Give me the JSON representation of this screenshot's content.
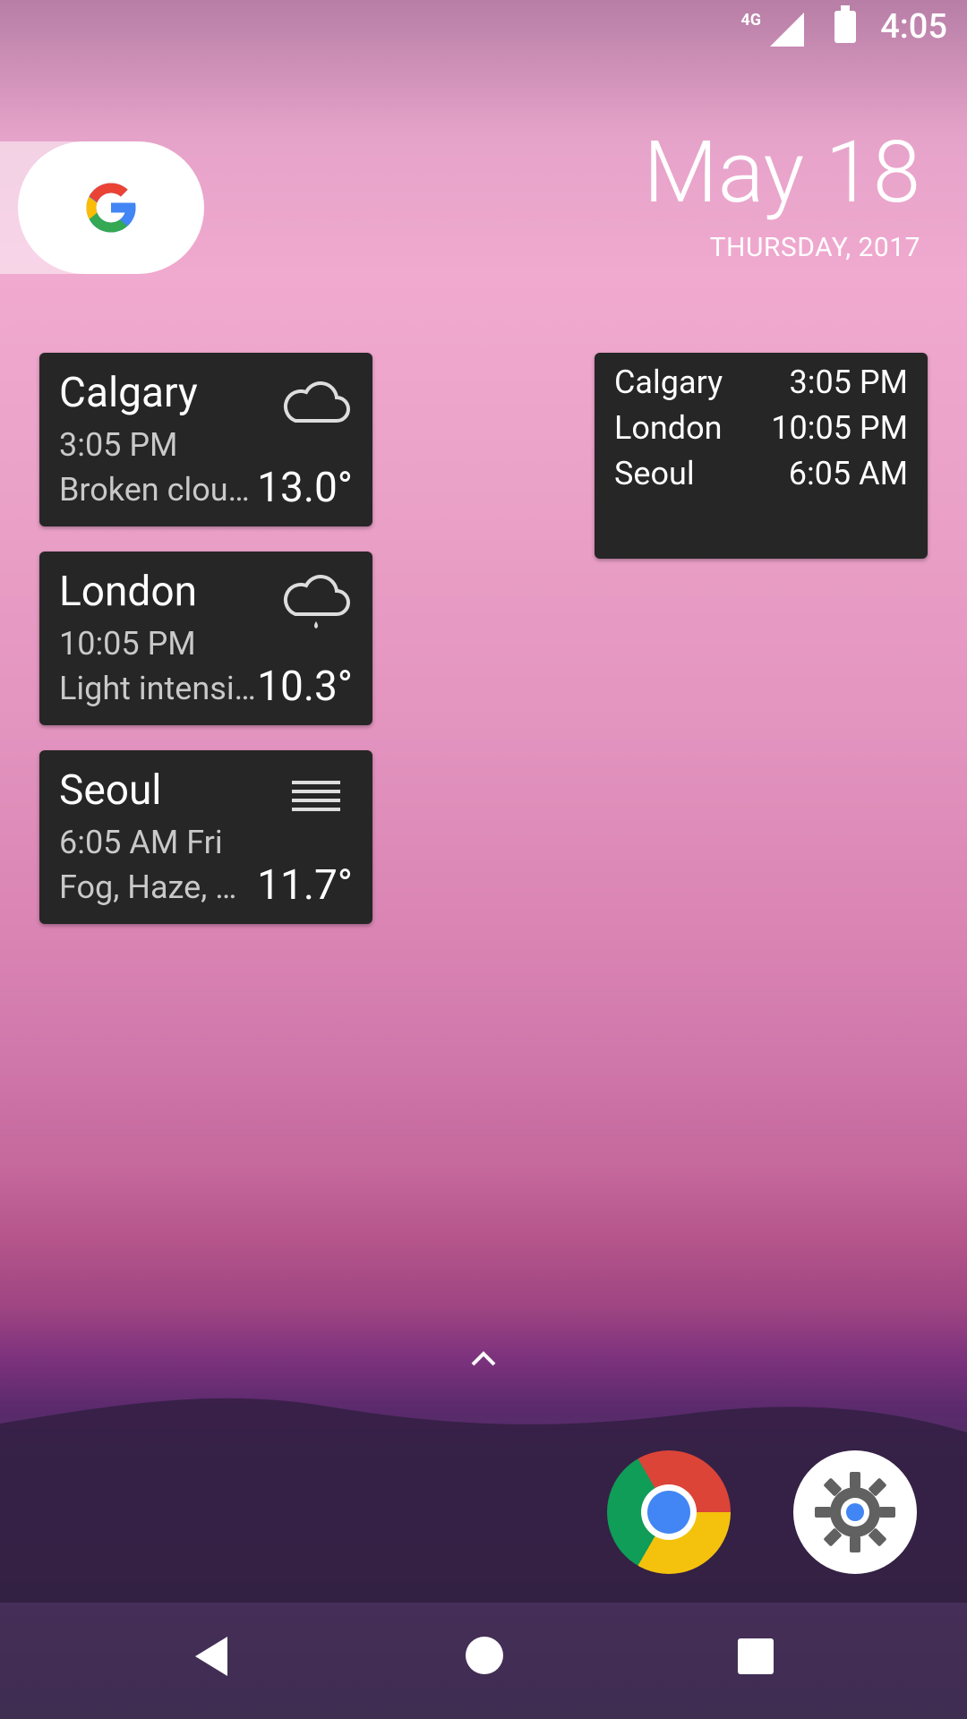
{
  "status_bar": {
    "network": "4G",
    "time": "4:05"
  },
  "search_widget": {
    "logo_name": "google-g-icon"
  },
  "date_widget": {
    "date": "May 18",
    "day_year": "THURSDAY, 2017"
  },
  "weather_cards": [
    {
      "city": "Calgary",
      "time": "3:05 PM",
      "desc": "Broken clouds",
      "temp": "13.0°",
      "icon": "cloud-icon"
    },
    {
      "city": "London",
      "time": "10:05 PM",
      "desc": "Light intensity drizzle",
      "temp": "10.3°",
      "icon": "rain-cloud-icon"
    },
    {
      "city": "Seoul",
      "time": "6:05 AM Fri",
      "desc": "Fog, Haze, Mist",
      "temp": "11.7°",
      "icon": "fog-icon"
    }
  ],
  "world_clock": [
    {
      "city": "Calgary",
      "time": "3:05 PM"
    },
    {
      "city": "London",
      "time": "10:05 PM"
    },
    {
      "city": "Seoul",
      "time": "6:05 AM"
    }
  ],
  "dock": {
    "apps": [
      {
        "name": "Chrome",
        "icon": "chrome-icon"
      },
      {
        "name": "Settings",
        "icon": "settings-gear-icon"
      }
    ]
  },
  "nav": {
    "back": "back-icon",
    "home": "home-icon",
    "recents": "recents-icon"
  }
}
